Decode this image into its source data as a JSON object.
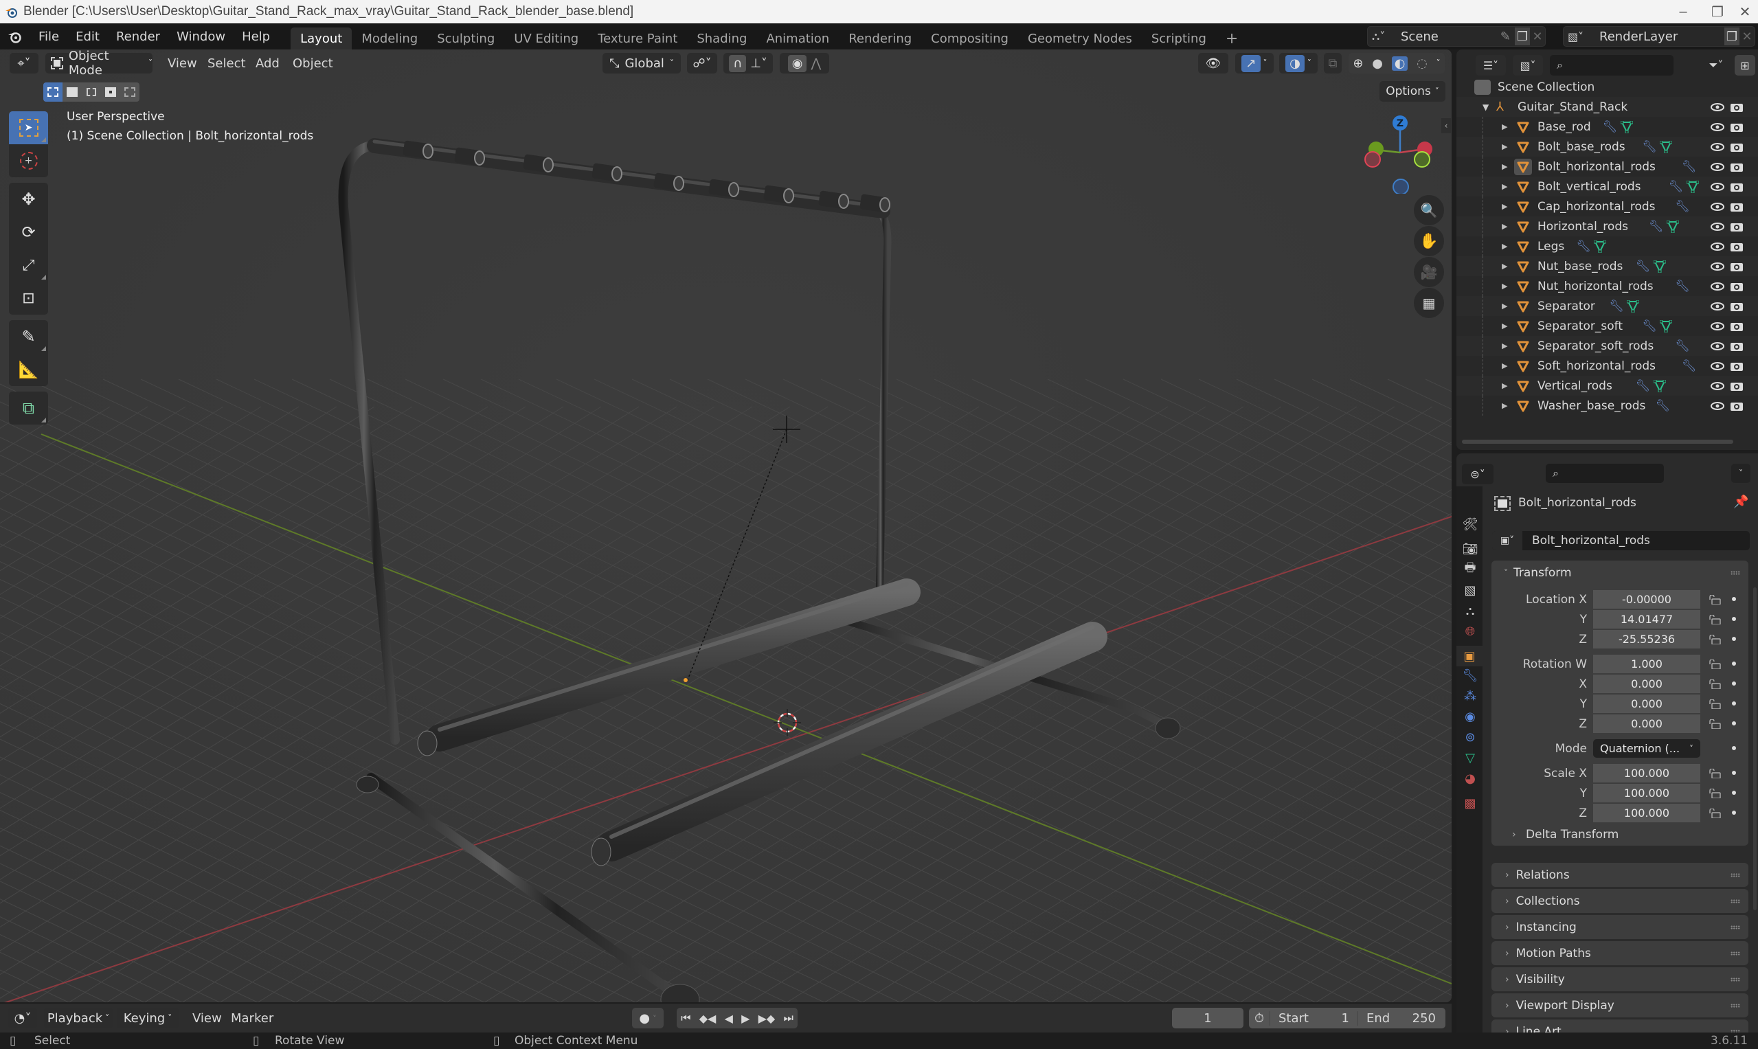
{
  "window": {
    "title": "Blender [C:\\Users\\User\\Desktop\\Guitar_Stand_Rack_max_vray\\Guitar_Stand_Rack_blender_base.blend]",
    "controls": [
      "minimize",
      "maximize",
      "close"
    ]
  },
  "topbar": {
    "menus": [
      "File",
      "Edit",
      "Render",
      "Window",
      "Help"
    ],
    "workspaces": [
      "Layout",
      "Modeling",
      "Sculpting",
      "UV Editing",
      "Texture Paint",
      "Shading",
      "Animation",
      "Rendering",
      "Compositing",
      "Geometry Nodes",
      "Scripting"
    ],
    "active_workspace": "Layout",
    "add_workspace": "+",
    "scene": "Scene",
    "view_layer": "RenderLayer"
  },
  "viewport": {
    "mode": "Object Mode",
    "menus": [
      "View",
      "Select",
      "Add",
      "Object"
    ],
    "transform_orientation": "Global",
    "options_label": "Options",
    "overlay_line1": "User Perspective",
    "overlay_line2": "(1) Scene Collection | Bolt_horizontal_rods",
    "gizmo_axes": {
      "z": "Z",
      "y": "Y",
      "x": "X"
    },
    "tools": [
      "select-box",
      "cursor",
      "move",
      "rotate",
      "scale",
      "transform",
      "annotate",
      "measure",
      "add-cube"
    ],
    "active_tool": "select-box",
    "shading_modes": [
      "wireframe",
      "solid",
      "material-preview",
      "rendered"
    ],
    "active_shading": "material-preview",
    "colors": {
      "x_axis": "#a83b45",
      "y_axis": "#6d8a2c",
      "grid": "#444444",
      "accent": "#4772b3"
    }
  },
  "timeline": {
    "menus": [
      "Playback",
      "Keying",
      "View",
      "Marker"
    ],
    "current_frame": "1",
    "start_label": "Start",
    "start": "1",
    "end_label": "End",
    "end": "250"
  },
  "statusbar": {
    "hints": [
      "Select",
      "Rotate View",
      "Object Context Menu"
    ],
    "version": "3.6.11"
  },
  "outliner": {
    "root": "Scene Collection",
    "collection": "Guitar_Stand_Rack",
    "items": [
      {
        "name": "Base_rod",
        "modifier": true,
        "mesh": true
      },
      {
        "name": "Bolt_base_rods",
        "modifier": true,
        "mesh": true
      },
      {
        "name": "Bolt_horizontal_rods",
        "modifier": true,
        "mesh": false,
        "selected": true
      },
      {
        "name": "Bolt_vertical_rods",
        "modifier": true,
        "mesh": true
      },
      {
        "name": "Cap_horizontal_rods",
        "modifier": true,
        "mesh": false
      },
      {
        "name": "Horizontal_rods",
        "modifier": true,
        "mesh": true
      },
      {
        "name": "Legs",
        "modifier": true,
        "mesh": true
      },
      {
        "name": "Nut_base_rods",
        "modifier": true,
        "mesh": true
      },
      {
        "name": "Nut_horizontal_rods",
        "modifier": true,
        "mesh": false
      },
      {
        "name": "Separator",
        "modifier": true,
        "mesh": true
      },
      {
        "name": "Separator_soft",
        "modifier": true,
        "mesh": true
      },
      {
        "name": "Separator_soft_rods",
        "modifier": true,
        "mesh": false
      },
      {
        "name": "Soft_horizontal_rods",
        "modifier": true,
        "mesh": false
      },
      {
        "name": "Vertical_rods",
        "modifier": true,
        "mesh": true
      },
      {
        "name": "Washer_base_rods",
        "modifier": true,
        "mesh": false
      }
    ]
  },
  "properties": {
    "context_name": "Bolt_horizontal_rods",
    "object_name": "Bolt_horizontal_rods",
    "transform": {
      "title": "Transform",
      "location": {
        "label": "Location X",
        "x": "-0.00000",
        "y": "14.01477",
        "z": "-25.55236"
      },
      "rotation": {
        "label": "Rotation W",
        "w": "1.000",
        "x": "0.000",
        "y": "0.000",
        "z": "0.000"
      },
      "mode_label": "Mode",
      "mode": "Quaternion (...",
      "scale": {
        "label": "Scale X",
        "x": "100.000",
        "y": "100.000",
        "z": "100.000"
      },
      "axis_labels": {
        "x": "X",
        "y": "Y",
        "z": "Z"
      },
      "delta": "Delta Transform"
    },
    "collapsed_panels": [
      "Relations",
      "Collections",
      "Instancing",
      "Motion Paths",
      "Visibility",
      "Viewport Display",
      "Line Art"
    ],
    "tabs": [
      "tool",
      "render",
      "output",
      "view-layer",
      "scene",
      "world",
      "object",
      "modifiers",
      "particles",
      "physics",
      "constraints",
      "data",
      "material",
      "texture"
    ],
    "active_tab": "object"
  }
}
